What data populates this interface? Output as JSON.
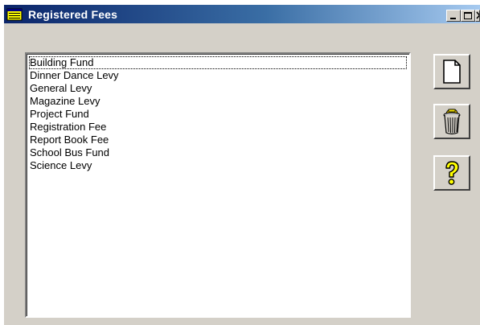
{
  "window": {
    "title": "Registered Fees",
    "icons": {
      "app": "notepad-icon",
      "minimize": "minimize-icon",
      "maximize": "maximize-icon",
      "close": "close-icon"
    }
  },
  "fees_list": {
    "selected_index": 0,
    "items": [
      "Building Fund",
      "Dinner Dance Levy",
      "General Levy",
      "Magazine Levy",
      "Project Fund",
      "Registration Fee",
      "Report Book Fee",
      "School Bus Fund",
      "Science Levy"
    ]
  },
  "toolbar": {
    "buttons": [
      {
        "icon": "new-document-icon"
      },
      {
        "icon": "recycle-bin-icon"
      },
      {
        "icon": "help-question-icon"
      }
    ]
  },
  "colors": {
    "titlebar_start": "#0a246a",
    "titlebar_end": "#a6caf0",
    "face": "#d4d0c8",
    "help_yellow": "#ffff00"
  }
}
